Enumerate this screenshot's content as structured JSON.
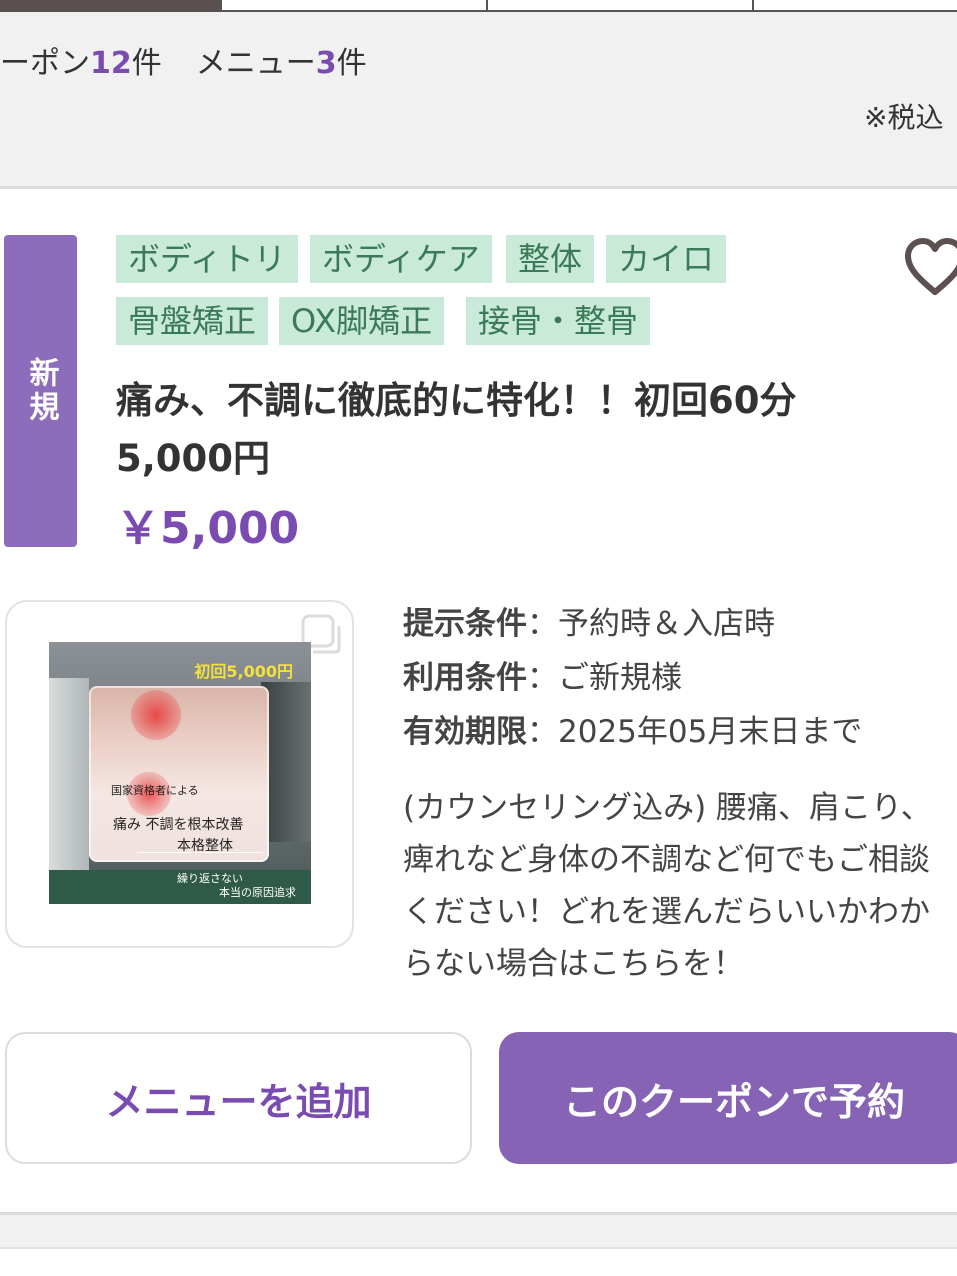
{
  "summary": {
    "coupon_prefix": "ーポン",
    "coupon_count": "12",
    "coupon_unit": "件",
    "menu_prefix": "メニュー",
    "menu_count": "3",
    "menu_unit": "件",
    "tax_note": "※税込"
  },
  "coupon": {
    "badge": "新規",
    "tags": [
      "ボディトリ",
      "ボディケア",
      "整体",
      "カイロ",
      "骨盤矯正",
      "OX脚矯正",
      "接骨・整骨"
    ],
    "title": "痛み、不調に徹底的に特化！！初回60分5,000円",
    "price": "￥5,000",
    "favorite_icon": "heart-icon",
    "image": {
      "price_text": "初回5,000円",
      "qualification_text": "国家資格者による",
      "main_text": "痛み 不調を根本改善",
      "sub_text": "本格整体",
      "caption1": "繰り返さない",
      "caption2": "本当の原因追求"
    },
    "conditions": [
      {
        "label": "提示条件",
        "value": "予約時＆入店時"
      },
      {
        "label": "利用条件",
        "value": "ご新規様"
      },
      {
        "label": "有効期限",
        "value": "2025年05月末日まで"
      }
    ],
    "description": "(カウンセリング込み) 腰痛、肩こり、痺れなど身体の不調など何でもご相談ください！どれを選んだらいいかわからない場合はこちらを！"
  },
  "buttons": {
    "add_menu": "メニューを追加",
    "reserve": "このクーポンで予約"
  },
  "colors": {
    "accent": "#7a4bb0",
    "badge": "#8e6cbc",
    "tag_bg": "#c9ead8",
    "tag_text": "#3b7a58",
    "reserve_button": "#8763b6"
  }
}
